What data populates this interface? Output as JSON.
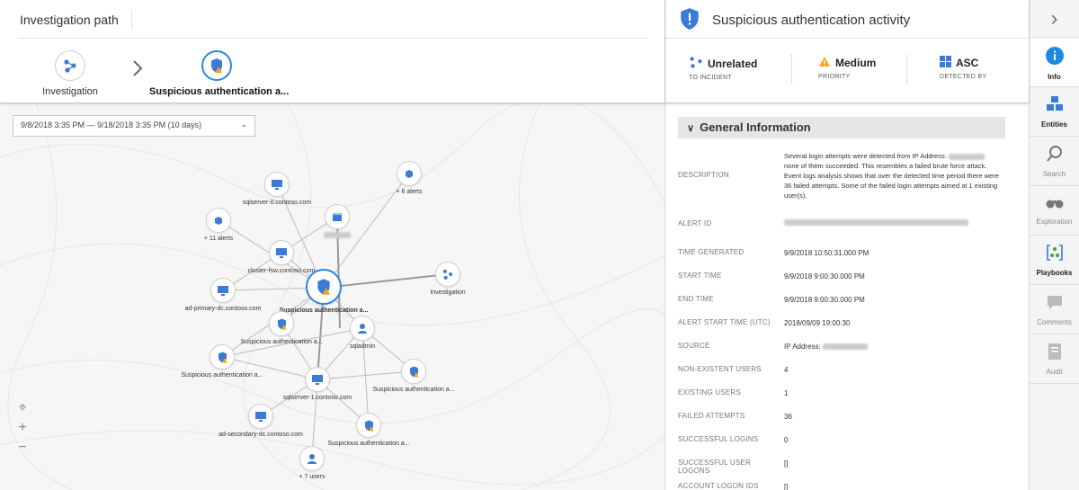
{
  "path": {
    "title": "Investigation path",
    "crumbs": [
      {
        "label": "Investigation"
      },
      {
        "label": "Suspicious authentication a..."
      }
    ]
  },
  "graph": {
    "date_range": "9/8/2018 3:35 PM — 9/18/2018 3:35 PM (10 days)",
    "nodes": {
      "sqlserver0": "sqlserver-0.contoso.com",
      "alerts6": "+ 6 alerts",
      "alerts11": "+ 11 alerts",
      "cluster": "cluster-fsw.contoso.com",
      "adprimary": "ad-primary-dc.contoso.com",
      "center": "Suspicious authentication a...",
      "investigation": "Investigation",
      "susp1": "Suspicious authentication a...",
      "sqladmin": "sqladmin",
      "susp2": "Suspicious authentication a...",
      "susp3": "Suspicious authentication a...",
      "sqlserver1": "sqlserver-1.contoso.com",
      "adsecondary": "ad-secondary-dc.contoso.com",
      "susp4": "Suspicious authentication a...",
      "users7": "+ 7 users"
    }
  },
  "alert": {
    "title": "Suspicious authentication activity",
    "stats": [
      {
        "value": "Unrelated",
        "label": "TO INCIDENT",
        "icon": "link-nodes-icon"
      },
      {
        "value": "Medium",
        "label": "PRIORITY",
        "icon": "warning-icon"
      },
      {
        "value": "ASC",
        "label": "DETECTED BY",
        "icon": "windows-icon"
      }
    ],
    "section_title": "General Information",
    "description_label": "DESCRIPTION",
    "description_pre": "Several login attempts were detected from IP Address:",
    "description_post": "none of them succeeded. This resembles a failed brute force attack. Event logs analysis shows that over the detected time period there were 36 failed attempts. Some of the failed login attempts aimed at 1 existing user(s).",
    "fields": [
      {
        "key": "ALERT ID",
        "value": ""
      },
      {
        "key": "TIME GENERATED",
        "value": "9/9/2018 10:50:31.000 PM"
      },
      {
        "key": "START TIME",
        "value": "9/9/2018 9:00:30.000 PM"
      },
      {
        "key": "END TIME",
        "value": "9/9/2018 9:00:30.000 PM"
      },
      {
        "key": "ALERT START TIME (UTC)",
        "value": "2018/09/09 19:00:30"
      },
      {
        "key": "SOURCE",
        "value": "IP Address:"
      },
      {
        "key": "NON-EXISTENT USERS",
        "value": "4"
      },
      {
        "key": "EXISTING USERS",
        "value": "1"
      },
      {
        "key": "FAILED ATTEMPTS",
        "value": "36"
      },
      {
        "key": "SUCCESSFUL LOGINS",
        "value": "0"
      },
      {
        "key": "SUCCESSFUL USER LOGONS",
        "value": "[]"
      },
      {
        "key": "ACCOUNT LOGON IDS",
        "value": "[]"
      }
    ]
  },
  "sidebar": {
    "collapse_glyph": "›",
    "items": [
      {
        "label": "Info"
      },
      {
        "label": "Entities"
      },
      {
        "label": "Search"
      },
      {
        "label": "Exploration"
      },
      {
        "label": "Playbooks"
      },
      {
        "label": "Comments"
      },
      {
        "label": "Audit"
      }
    ]
  },
  "colors": {
    "accent": "#2b88d8",
    "warning": "#f7a21b",
    "icon_blue": "#3a7bd5"
  }
}
